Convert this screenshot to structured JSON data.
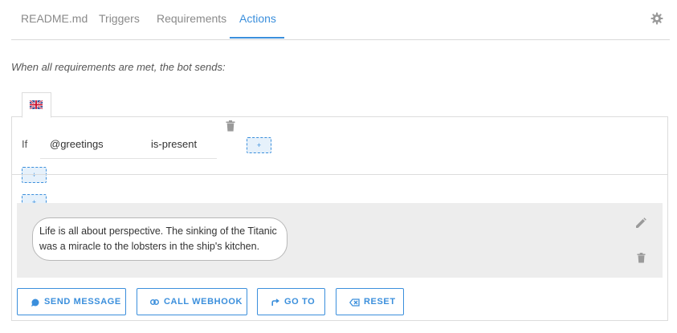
{
  "tabs": [
    {
      "label": "README.md",
      "active": false
    },
    {
      "label": "Triggers",
      "active": false
    },
    {
      "label": "Requirements",
      "active": false
    },
    {
      "label": "Actions",
      "active": true
    }
  ],
  "settings_icon": "gear-icon",
  "intro_text": "When all requirements are met, the bot sends:",
  "language_tab": {
    "icon": "uk-flag-icon"
  },
  "condition": {
    "if_label": "If",
    "variable": "@greetings",
    "operator": "is-present",
    "add_label": "+"
  },
  "add_condition_label": "+",
  "add_message_label": "+",
  "message": {
    "lines": [
      "Life is all about perspective. The sinking of the Titanic",
      "was a miracle to the lobsters in the ship's kitchen."
    ]
  },
  "actions": [
    {
      "label": "SEND MESSAGE",
      "icon": "chat-bubble-icon"
    },
    {
      "label": "CALL WEBHOOK",
      "icon": "link-icon"
    },
    {
      "label": "GO TO",
      "icon": "redirect-icon"
    },
    {
      "label": "RESET",
      "icon": "reset-icon"
    }
  ],
  "colors": {
    "accent": "#3b8fdc",
    "tab_inactive": "#8a8a8a",
    "border": "#dcdcdc",
    "message_area": "#ededed"
  }
}
